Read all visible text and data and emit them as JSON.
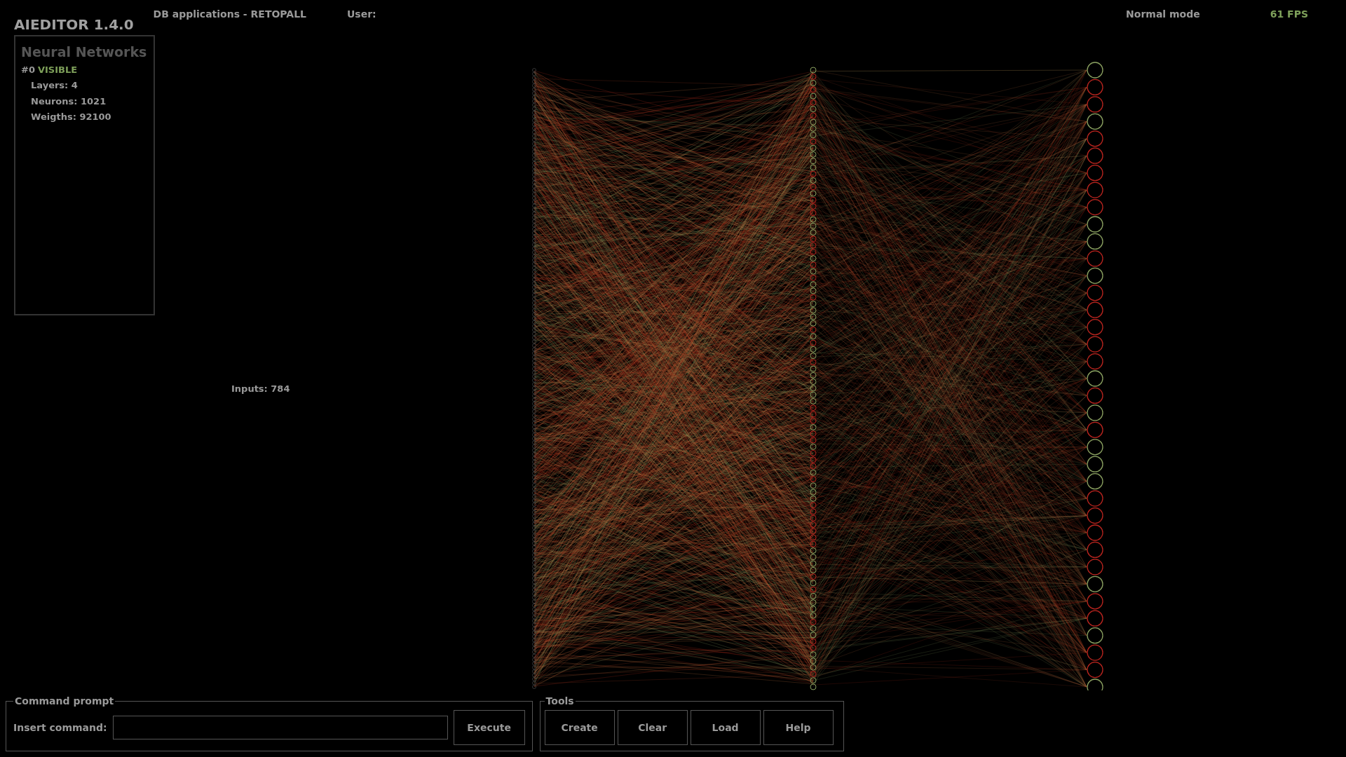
{
  "app": {
    "title": "AIEDITOR 1.4.0",
    "database": "DB applications - RETOPALL",
    "user_label": "User:",
    "mode": "Normal mode",
    "fps": "61 FPS"
  },
  "networks_panel": {
    "title": "Neural Networks",
    "networks": [
      {
        "index": "#0",
        "status": "VISIBLE",
        "layers": "Layers: 4",
        "neurons": "Neurons: 1021",
        "weights": "Weigths: 92100"
      }
    ]
  },
  "canvas": {
    "inputs_label": "Inputs: 784"
  },
  "command_prompt": {
    "legend": "Command prompt",
    "label": "Insert command:",
    "button": "Execute"
  },
  "tools": {
    "legend": "Tools",
    "buttons": [
      "Create",
      "Clear",
      "Load",
      "Help"
    ]
  }
}
